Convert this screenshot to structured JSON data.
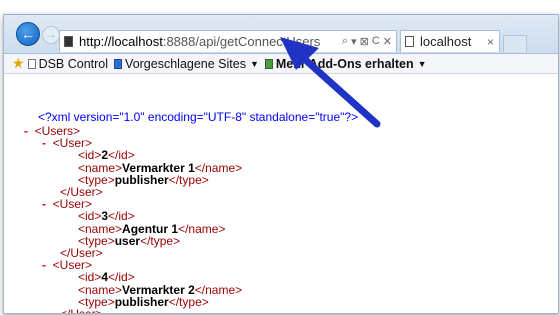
{
  "browser": {
    "address_host": "http://localhost",
    "address_rest": ":8888/api/getConnectUsers",
    "address_tools": [
      "⌕",
      "▾",
      "⊠",
      "C",
      "✕"
    ],
    "tab_title": "localhost",
    "tab_close": "×"
  },
  "favorites": {
    "items": [
      {
        "label": "DSB Control"
      },
      {
        "label": "Vorgeschlagene Sites"
      },
      {
        "label": "Mehr Add-Ons erhalten"
      }
    ]
  },
  "xml": {
    "declaration": "<?xml version=\"1.0\" encoding=\"UTF-8\" standalone=\"true\"?>",
    "root_open": "<Users>",
    "user_open": "<User>",
    "user_close": "</User>",
    "users": [
      {
        "id": "2",
        "name": "Vermarkter 1",
        "type": "publisher"
      },
      {
        "id": "3",
        "name": "Agentur 1",
        "type": "user"
      },
      {
        "id": "4",
        "name": "Vermarkter 2",
        "type": "publisher"
      }
    ],
    "minus": "-",
    "id_open": "<id>",
    "id_close": "</id>",
    "name_open": "<name>",
    "name_close": "</name>",
    "type_open": "<type>",
    "type_close": "</type>"
  },
  "colors": {
    "tag": "#990000",
    "declaration": "#0000ff",
    "collapse": "#ff0000",
    "annotation_arrow": "#1f33c4"
  }
}
